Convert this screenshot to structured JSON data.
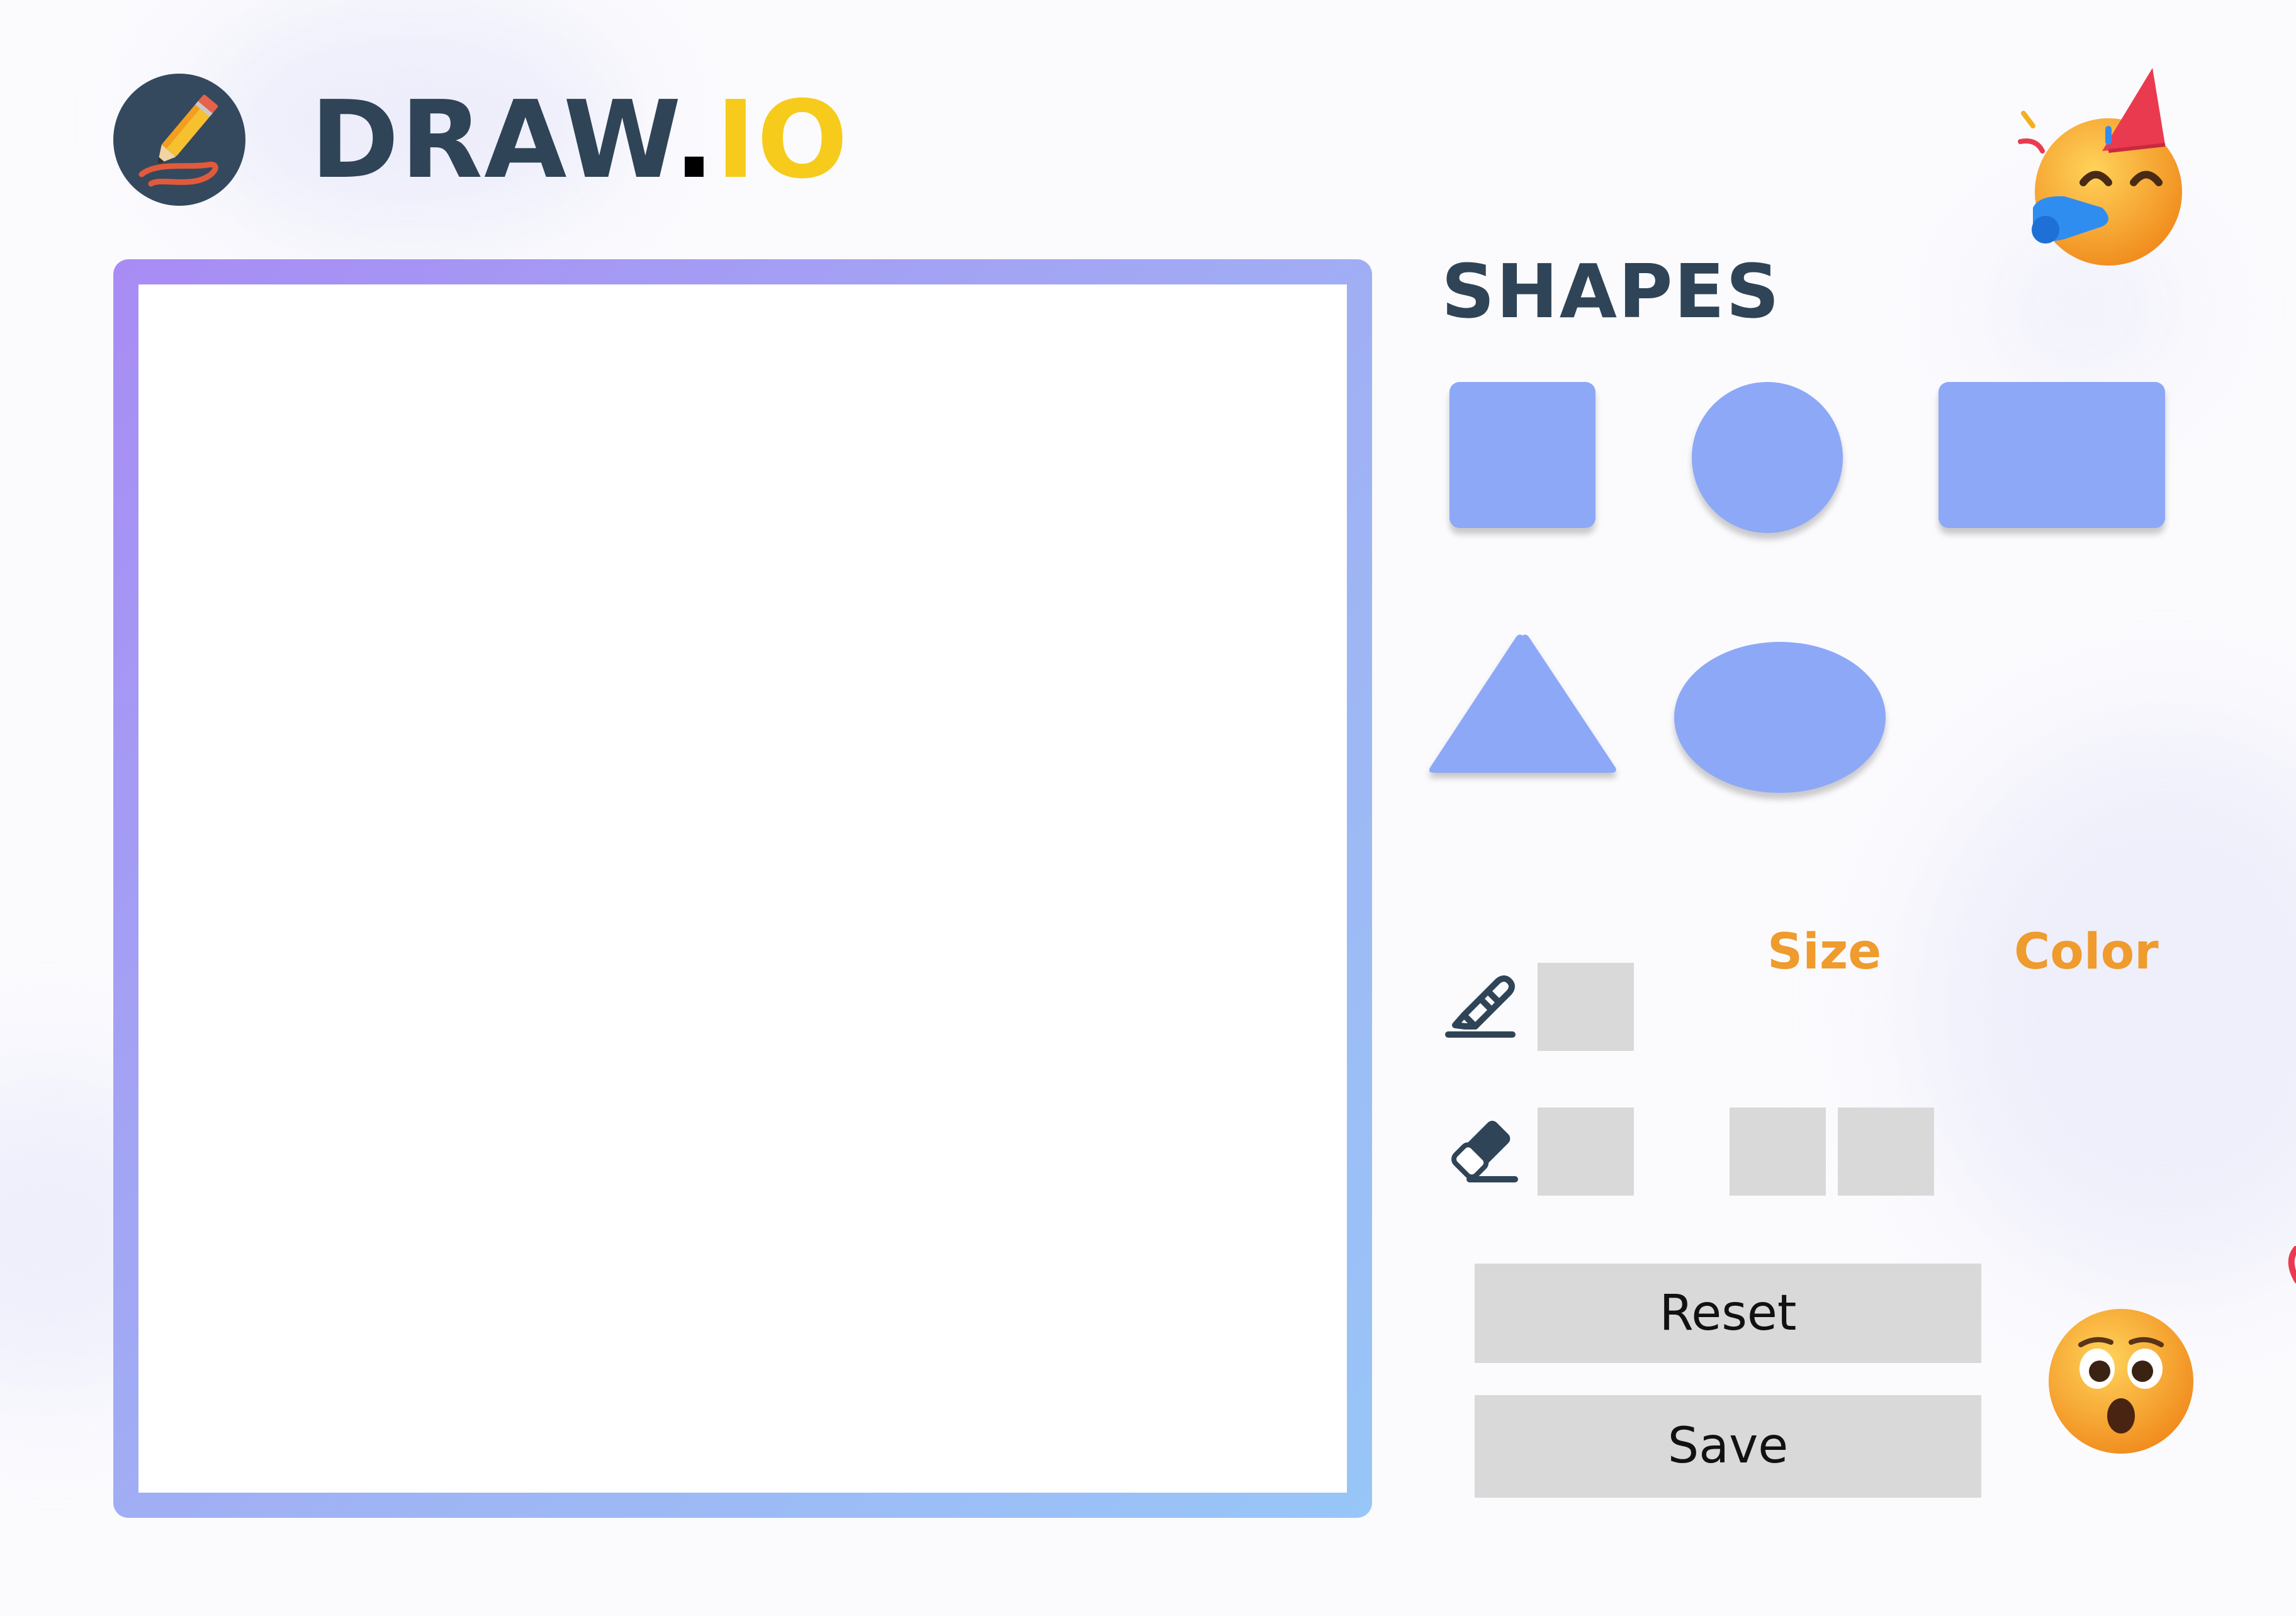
{
  "header": {
    "logo_icon": "pencil-scribble-icon",
    "title_main": "DRAW",
    "title_dot": ".",
    "title_suffix": "IO"
  },
  "canvas": {
    "frame_gradient": [
      "#a88cf4",
      "#98c6f8"
    ]
  },
  "shapes_panel": {
    "title": "SHAPES",
    "items": [
      {
        "name": "square",
        "icon": "square-shape"
      },
      {
        "name": "circle",
        "icon": "circle-shape"
      },
      {
        "name": "rectangle",
        "icon": "rectangle-shape"
      },
      {
        "name": "triangle",
        "icon": "triangle-shape"
      },
      {
        "name": "ellipse",
        "icon": "ellipse-shape"
      }
    ],
    "shape_color": "#8da8f6"
  },
  "tools": {
    "size_label": "Size",
    "color_label": "Color",
    "pen_icon": "pen-icon",
    "eraser_icon": "eraser-icon",
    "swatch_color": "#d9d9d9"
  },
  "actions": {
    "reset_label": "Reset",
    "save_label": "Save"
  },
  "decorations": {
    "top_right": "party-face-emoji",
    "bottom_right": "astonished-face-emoji"
  },
  "colors": {
    "title_dark": "#2f4456",
    "accent_yellow": "#f7cb1c",
    "label_orange": "#ef9b2d"
  }
}
